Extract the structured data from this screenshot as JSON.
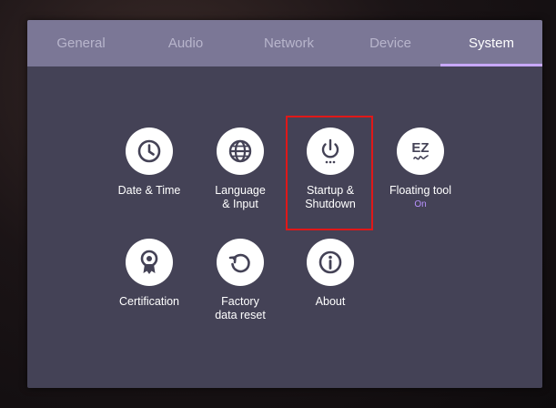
{
  "tabs": [
    {
      "label": "General"
    },
    {
      "label": "Audio"
    },
    {
      "label": "Network"
    },
    {
      "label": "Device"
    },
    {
      "label": "System"
    }
  ],
  "active_tab": "System",
  "items": [
    {
      "label": "Date & Time",
      "icon": "clock-icon"
    },
    {
      "label": "Language\n& Input",
      "icon": "globe-icon"
    },
    {
      "label": "Startup &\nShutdown",
      "icon": "power-icon"
    },
    {
      "label": "Floating tool",
      "icon": "ez-pen-icon",
      "status": "On"
    },
    {
      "label": "Certification",
      "icon": "award-ribbon-icon"
    },
    {
      "label": "Factory\ndata reset",
      "icon": "reset-arrow-icon"
    },
    {
      "label": "About",
      "icon": "info-icon"
    }
  ],
  "colors": {
    "panel_bg": "#444256",
    "tabbar_bg": "#7b7796",
    "active_accent": "#c8a8ff",
    "status_on": "#b892ff",
    "highlight_border": "#e01818"
  }
}
